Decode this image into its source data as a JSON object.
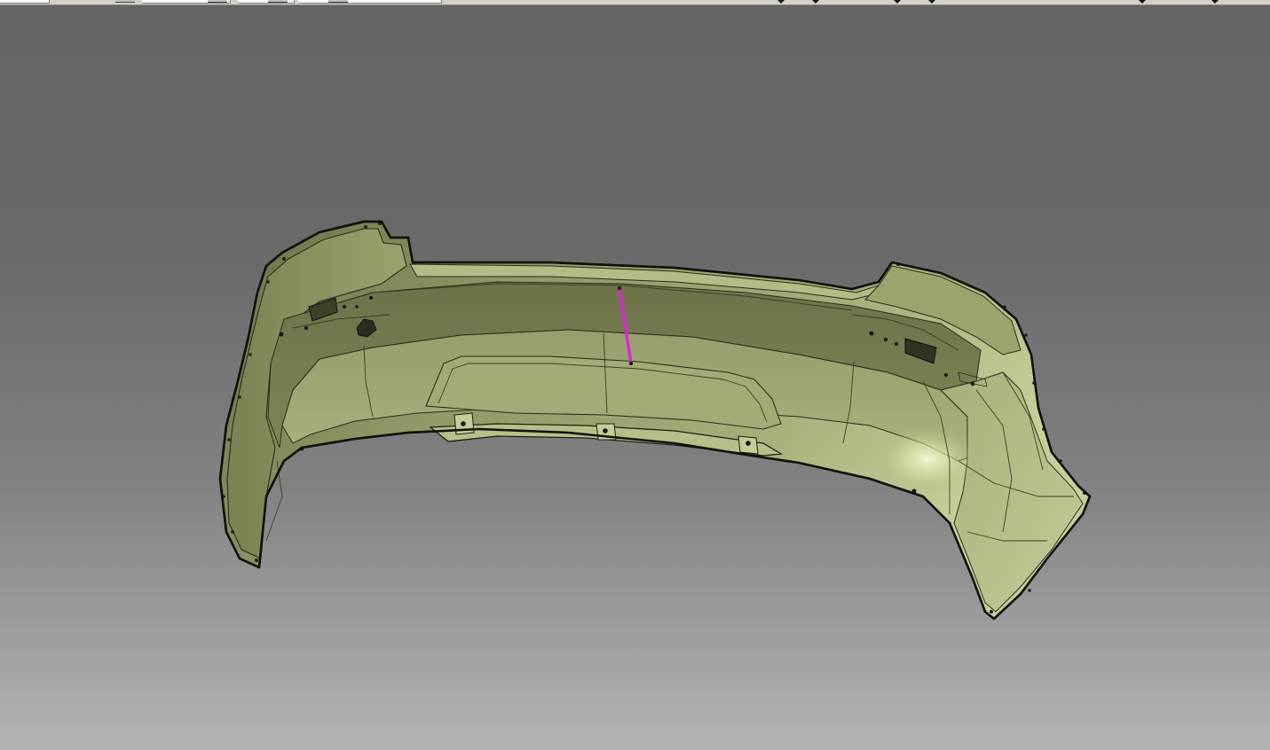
{
  "app": {
    "type": "3d-cad-viewer"
  },
  "toolbar": {
    "field_count": 6,
    "dropdown_icon": "chevron-down-icon"
  },
  "viewport": {
    "background_top": "#646464",
    "background_bottom": "#b4b4b4",
    "model": {
      "part": "rear-bumper-fascia",
      "surface_color": "#a3ad78",
      "edge_color": "#1c1f12",
      "highlight_color": "#e6f0c4"
    },
    "selected_edge": {
      "color": "#e21ee2"
    }
  }
}
